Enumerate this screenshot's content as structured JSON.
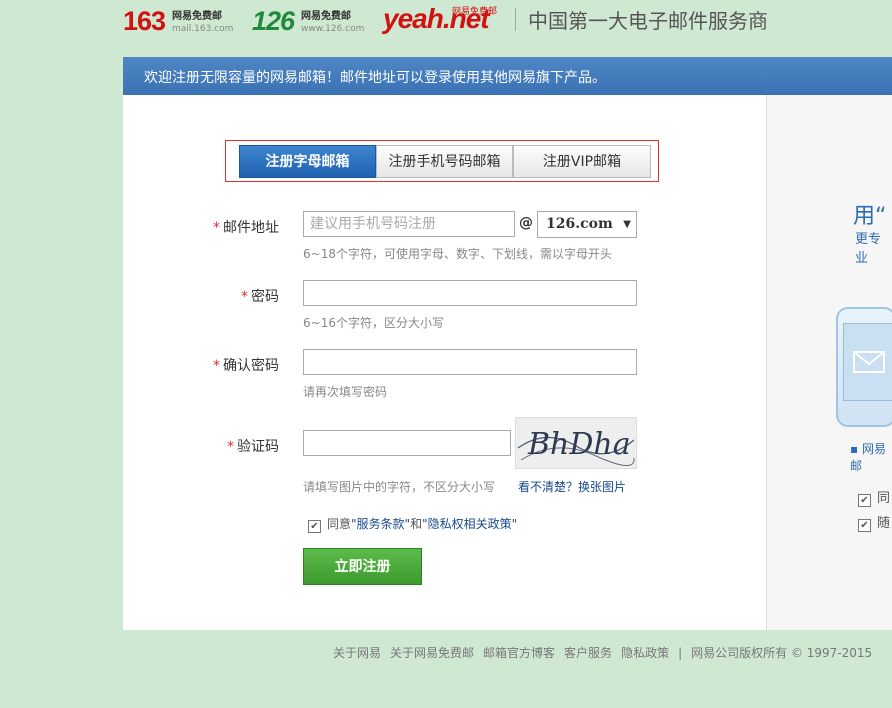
{
  "header": {
    "logo163": "163",
    "logo163_cn": "网易免费邮",
    "logo163_url": "mail.163.com",
    "logo126": "126",
    "logo126_cn": "网易免费邮",
    "logo126_url": "www.126.com",
    "logoyeah": "yeah",
    "logoyeah_net": ".net",
    "logoyeah_tag": "网易免费邮",
    "slogan": "中国第一大电子邮件服务商"
  },
  "banner": "欢迎注册无限容量的网易邮箱！邮件地址可以登录使用其他网易旗下产品。",
  "tabs": [
    {
      "label": "注册字母邮箱"
    },
    {
      "label": "注册手机号码邮箱"
    },
    {
      "label": "注册VIP邮箱"
    }
  ],
  "form": {
    "required_mark": "*",
    "email_label": "邮件地址",
    "email_placeholder": "建议用手机号码注册",
    "at": "@",
    "domain": "126.com",
    "domain_arrow": "▼",
    "email_hint": "6~18个字符，可使用字母、数字、下划线，需以字母开头",
    "password_label": "密码",
    "password_hint": "6~16个字符，区分大小写",
    "confirm_label": "确认密码",
    "confirm_hint": "请再次填写密码",
    "captcha_label": "验证码",
    "captcha_text": "BhDha",
    "captcha_hint": "请填写图片中的字符，不区分大小写",
    "captcha_refresh": "看不清楚？换张图片",
    "agree_prefix": "同意",
    "agree_terms": "\"服务条款\"",
    "agree_and": "和",
    "agree_privacy": "\"隐私权相关政策\"",
    "submit": "立即注册"
  },
  "side": {
    "title": "用“",
    "subtitle": "更专业",
    "li": "▪ 网易邮",
    "check1": "同",
    "check2": "随"
  },
  "footer": {
    "links": [
      "关于网易",
      "关于网易免费邮",
      "邮箱官方博客",
      "客户服务",
      "隐私政策"
    ],
    "divider": "|",
    "copyright": "网易公司版权所有 © 1997-2015"
  },
  "colors": {
    "background": "#cfe8d2",
    "banner": "#3a72b5",
    "tab_active": "#1f62b0",
    "submit": "#3d9a2e",
    "required": "#e03030"
  }
}
